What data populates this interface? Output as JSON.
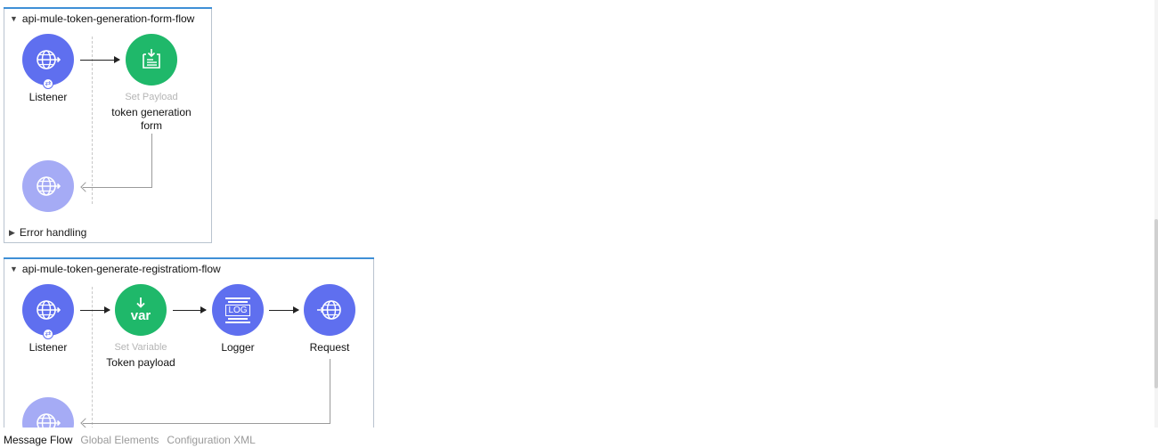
{
  "flows": [
    {
      "name": "api-mule-token-generation-form-flow",
      "components": {
        "listener": {
          "label": "Listener",
          "icon": "globe-icon"
        },
        "set_payload": {
          "type": "Set Payload",
          "label_line1": "token generation",
          "label_line2": "form",
          "icon": "set-payload-icon"
        }
      },
      "error_handling": "Error handling"
    },
    {
      "name": "api-mule-token-generate-registratiom-flow",
      "components": {
        "listener": {
          "label": "Listener",
          "icon": "globe-icon"
        },
        "set_variable": {
          "type": "Set Variable",
          "label": "Token payload",
          "icon_text": "var"
        },
        "logger": {
          "label": "Logger",
          "icon_text": "LOG"
        },
        "request": {
          "label": "Request",
          "icon": "globe-icon"
        }
      }
    }
  ],
  "tabs": [
    "Message Flow",
    "Global Elements",
    "Configuration XML"
  ],
  "active_tab": "Message Flow",
  "colors": {
    "connector": "#5f6fef",
    "transformer": "#1fb86a",
    "source_faded": "#a5abf5",
    "flow_accent": "#3f8fd6"
  }
}
